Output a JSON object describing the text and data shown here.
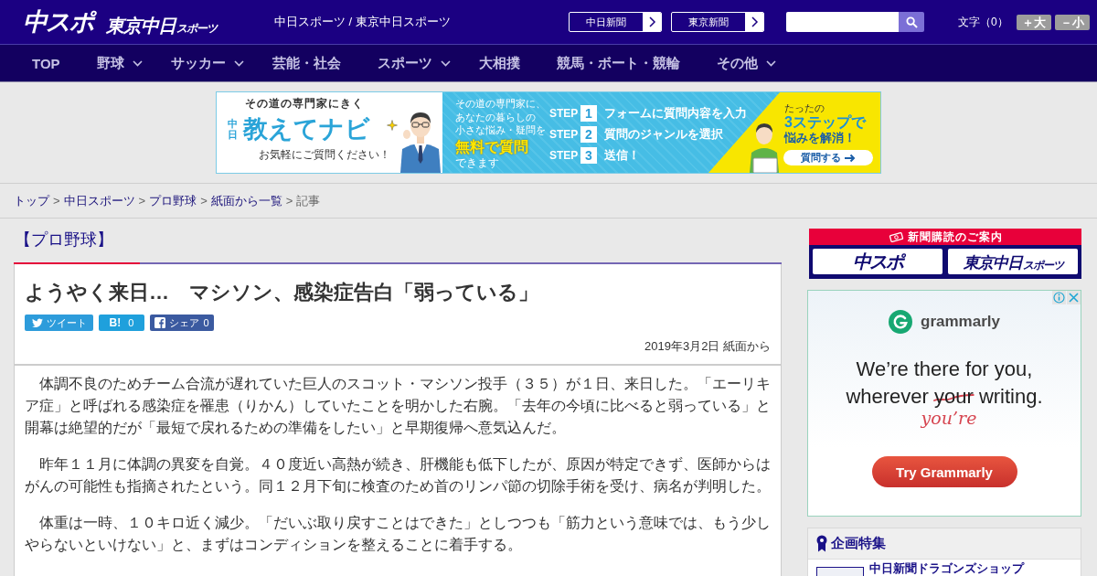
{
  "header": {
    "logos": [
      {
        "text": "中スポ",
        "kind": "main"
      },
      {
        "text": "東京中日",
        "sub": "スポーツ",
        "kind": "tokyo"
      }
    ],
    "tagline": "中日スポーツ / 東京中日スポーツ",
    "paper_links": [
      {
        "label": "中日新聞"
      },
      {
        "label": "東京新聞"
      }
    ],
    "font_size": {
      "label": "文字（0）",
      "buttons": [
        {
          "label": "＋大"
        },
        {
          "label": "－小"
        }
      ]
    }
  },
  "nav": [
    {
      "label": "TOP",
      "dropdown": false
    },
    {
      "label": "野球",
      "dropdown": true
    },
    {
      "label": "サッカー",
      "dropdown": true
    },
    {
      "label": "芸能・社会",
      "dropdown": false
    },
    {
      "label": "スポーツ",
      "dropdown": true
    },
    {
      "label": "大相撲",
      "dropdown": false
    },
    {
      "label": "競馬・ボート・競輪",
      "dropdown": false
    },
    {
      "label": "その他",
      "dropdown": true
    }
  ],
  "banner_ad": {
    "tagline": "その道の専門家にきく",
    "brand_prefix": "中日",
    "brand": "教えてナビ",
    "note": "お気軽にご質問ください！",
    "copy_lines": [
      "その道の専門家に、",
      "あなたの暮らしの",
      "小さな悩み・疑問を"
    ],
    "copy_highlight": "無料で質問",
    "copy_tail": "できます",
    "steps": [
      {
        "label": "STEP",
        "number": "1",
        "text": "フォームに質問内容を入力"
      },
      {
        "label": "STEP",
        "number": "2",
        "text": "質問のジャンルを選択"
      },
      {
        "label": "STEP",
        "number": "3",
        "text": "送信！"
      }
    ],
    "kicker": "たったの",
    "headline": "3ステップで",
    "subline": "悩みを解消！",
    "button": "質問する"
  },
  "breadcrumb": [
    {
      "label": "トップ",
      "kind": "link"
    },
    {
      "label": ">",
      "kind": "separator"
    },
    {
      "label": "中日スポーツ",
      "kind": "link"
    },
    {
      "label": ">",
      "kind": "separator"
    },
    {
      "label": "プロ野球",
      "kind": "link"
    },
    {
      "label": ">",
      "kind": "separator"
    },
    {
      "label": "紙面から一覧",
      "kind": "link"
    },
    {
      "label": ">",
      "kind": "separator"
    },
    {
      "label": "記事",
      "kind": "current"
    }
  ],
  "article": {
    "category": "【プロ野球】",
    "title": "ようやく来日…　マシソン、感染症告白「弱っている」",
    "share_buttons": [
      {
        "kind": "twitter",
        "label": "ツイート"
      },
      {
        "kind": "hatena",
        "label": "B!",
        "count": "0"
      },
      {
        "kind": "facebook",
        "label": "シェア",
        "count": "0"
      }
    ],
    "date": "2019年3月2日 紙面から",
    "paragraphs": [
      "体調不良のためチーム合流が遅れていた巨人のスコット・マシソン投手（３５）が１日、来日した。「エーリキア症」と呼ばれる感染症を罹患（りかん）していたことを明かした右腕。「去年の今頃に比べると弱っている」と開幕は絶望的だが「最短で戻れるための準備をしたい」と早期復帰へ意気込んだ。",
      "昨年１１月に体調の異変を自覚。４０度近い高熱が続き、肝機能も低下したが、原因が特定できず、医師からはがんの可能性も指摘されたという。同１２月下旬に検査のため首のリンパ節の切除手術を受け、病名が判明した。",
      "体重は一時、１０キロ近く減少。「だいぶ取り戻すことはできた」としつつも「筋力という意味では、もう少しやらないといけない」と、まずはコンディションを整えることに着手する。"
    ]
  },
  "sidebar": {
    "subscription": {
      "title": "新聞購読のご案内",
      "papers": [
        {
          "text": "中スポ",
          "kind": "main"
        },
        {
          "text": "東京中日",
          "sub": "スポーツ",
          "kind": "tokyo"
        }
      ]
    },
    "ad": {
      "brand": "grammarly",
      "line_1": "We’re there for you,",
      "line_2_before": "wherever",
      "struck": "your",
      "line_2_after": "writing.",
      "correction": "you’re",
      "button": "Try Grammarly"
    },
    "features": {
      "title": "企画特集",
      "items": [
        {
          "label": "中日新聞ドラゴンズショップ"
        }
      ]
    }
  }
}
